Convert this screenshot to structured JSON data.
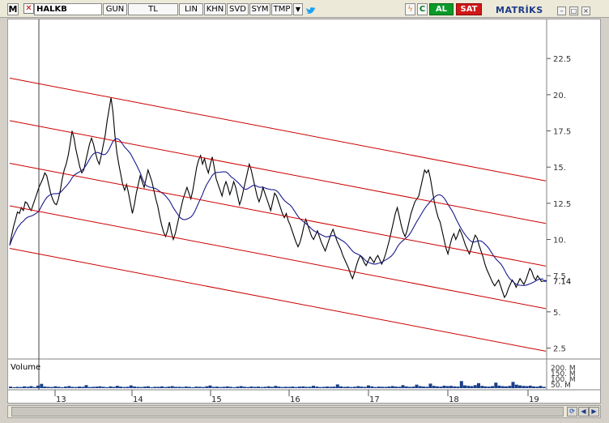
{
  "toolbar": {
    "logo": "M",
    "check_icon": "x-mark-icon",
    "symbol": "HALKB",
    "period": "GUN",
    "currency": "TL",
    "scale": "LIN",
    "line_type": "KHN",
    "save": "SVD",
    "sym_button": "SYM",
    "template": "TMP",
    "dropdown_icon": "triangle-down-icon",
    "twitter_icon": "bird-icon",
    "refresh_icon": "lightning-icon",
    "currency_icon": "dollar-icon",
    "c_button": "C",
    "buy": "AL",
    "sell": "SAT",
    "brand": "MATRİKS",
    "window_buttons": [
      "minimize-icon",
      "maximize-icon",
      "close-icon"
    ],
    "colors": {
      "buy": "#0a9a2a",
      "sell": "#d01818",
      "brand": "#1e3a8a"
    }
  },
  "chart_data": [
    {
      "type": "line",
      "series": [
        {
          "values": [
            9.6,
            10.3,
            10.9,
            11.4,
            11.9,
            11.8,
            12.2,
            12.0,
            12.6,
            12.5,
            12.2,
            12.0,
            12.4,
            12.8,
            13.2,
            13.6,
            13.9,
            14.2,
            14.6,
            14.4,
            13.8,
            13.2,
            12.8,
            12.5,
            12.4,
            12.8,
            13.4,
            14.2,
            14.8,
            15.2,
            15.8,
            16.6,
            17.5,
            17.0,
            16.2,
            15.6,
            15.0,
            14.6,
            14.8,
            15.4,
            16.0,
            16.6,
            17.0,
            16.6,
            16.0,
            15.5,
            15.2,
            15.8,
            16.5,
            17.2,
            18.2,
            19.0,
            19.8,
            18.8,
            17.2,
            16.0,
            15.2,
            14.5,
            13.8,
            13.4,
            13.8,
            13.2,
            12.5,
            11.8,
            12.4,
            13.2,
            13.8,
            14.4,
            14.0,
            13.6,
            14.2,
            14.8,
            14.4,
            14.0,
            13.4,
            12.8,
            12.3,
            11.6,
            11.0,
            10.5,
            10.2,
            10.6,
            11.2,
            10.5,
            10.0,
            10.4,
            11.0,
            11.6,
            12.2,
            12.8,
            13.2,
            13.6,
            13.2,
            12.8,
            13.4,
            14.2,
            15.0,
            15.5,
            15.8,
            15.2,
            15.6,
            15.0,
            14.6,
            15.2,
            15.7,
            15.0,
            14.2,
            13.8,
            13.4,
            13.0,
            13.6,
            14.0,
            13.6,
            13.1,
            13.5,
            14.0,
            13.6,
            13.0,
            12.4,
            12.8,
            13.4,
            14.0,
            14.6,
            15.2,
            14.8,
            14.2,
            13.6,
            13.0,
            12.6,
            13.0,
            13.6,
            13.2,
            12.8,
            12.4,
            12.0,
            12.6,
            13.2,
            13.0,
            12.6,
            12.2,
            11.8,
            11.5,
            11.8,
            11.3,
            11.0,
            10.6,
            10.2,
            9.8,
            9.5,
            9.8,
            10.3,
            10.9,
            11.4,
            11.0,
            10.6,
            10.2,
            10.0,
            10.3,
            10.6,
            10.2,
            9.8,
            9.5,
            9.2,
            9.6,
            10.0,
            10.4,
            10.7,
            10.3,
            9.9,
            9.6,
            9.3,
            8.9,
            8.6,
            8.3,
            8.0,
            7.6,
            7.3,
            7.7,
            8.2,
            8.6,
            8.9,
            8.7,
            8.4,
            8.2,
            8.5,
            8.8,
            8.6,
            8.4,
            8.7,
            8.9,
            8.6,
            8.3,
            8.6,
            9.0,
            9.5,
            10.0,
            10.6,
            11.2,
            11.8,
            12.2,
            11.6,
            11.0,
            10.5,
            10.2,
            10.6,
            11.2,
            11.8,
            12.2,
            12.6,
            12.8,
            13.0,
            13.6,
            14.2,
            14.8,
            14.6,
            14.8,
            14.2,
            13.4,
            12.6,
            12.0,
            11.5,
            11.2,
            10.6,
            10.0,
            9.4,
            9.0,
            9.6,
            10.1,
            10.4,
            10.0,
            10.3,
            10.7,
            10.4,
            10.0,
            9.6,
            9.3,
            9.0,
            9.4,
            9.9,
            10.3,
            10.1,
            9.6,
            9.2,
            8.8,
            8.3,
            7.9,
            7.6,
            7.3,
            7.0,
            6.8,
            7.0,
            7.2,
            6.8,
            6.4,
            6.0,
            6.2,
            6.6,
            6.9,
            7.2,
            7.0,
            6.7,
            7.0,
            7.3,
            7.1,
            6.9,
            7.2,
            7.6,
            8.0,
            7.8,
            7.4,
            7.2,
            7.5,
            7.3,
            7.1,
            7.14
          ]
        },
        {
          "values": []
        }
      ],
      "x_tick_labels": [
        "13",
        "14",
        "15",
        "16",
        "17",
        "18",
        "19"
      ],
      "y_tick_labels": [
        "22.5",
        "20.",
        "17.5",
        "15.",
        "12.5",
        "10.",
        "7.5",
        "5.",
        "2.5"
      ],
      "last_value_label": "7.14",
      "ylim": [
        1.8,
        25.2
      ],
      "colors": {
        "price": "#000000",
        "moving_average": "#1a1a8c",
        "channel": "#cc0000",
        "last_value_marker": "#1a1a8c"
      }
    },
    {
      "type": "bar",
      "title": "Volume",
      "y_tick_labels": [
        "200. M",
        "150. M",
        "100. M",
        "50. M"
      ],
      "values": [
        12,
        8,
        10,
        9,
        14,
        11,
        16,
        9,
        20,
        34,
        13,
        10,
        9,
        15,
        11,
        8,
        12,
        17,
        10,
        9,
        13,
        11,
        24,
        9,
        10,
        12,
        15,
        11,
        8,
        14,
        10,
        19,
        12,
        9,
        11,
        22,
        13,
        10,
        9,
        12,
        15,
        8,
        11,
        10,
        14,
        9,
        12,
        16,
        10,
        11,
        9,
        13,
        10,
        8,
        12,
        11,
        9,
        15,
        21,
        10,
        12,
        9,
        11,
        14,
        10,
        8,
        12,
        16,
        11,
        9,
        13,
        10,
        12,
        9,
        11,
        15,
        10,
        18,
        12,
        9,
        11,
        10,
        13,
        9,
        12,
        14,
        10,
        11,
        19,
        12,
        9,
        10,
        13,
        11,
        12,
        30,
        14,
        10,
        12,
        9,
        11,
        16,
        12,
        10,
        22,
        14,
        9,
        12,
        11,
        10,
        13,
        17,
        12,
        11,
        24,
        14,
        10,
        12,
        28,
        16,
        13,
        11,
        36,
        18,
        14,
        12,
        20,
        16,
        18,
        14,
        12,
        56,
        22,
        18,
        16,
        24,
        40,
        18,
        14,
        12,
        16,
        44,
        20,
        16,
        14,
        18,
        50,
        28,
        22,
        18,
        16,
        20,
        14,
        12,
        18,
        10
      ]
    }
  ],
  "scroll": {
    "prev_icon": "arrow-left-icon",
    "next_icon": "arrow-right-icon",
    "sync_icon": "sync-icon"
  }
}
